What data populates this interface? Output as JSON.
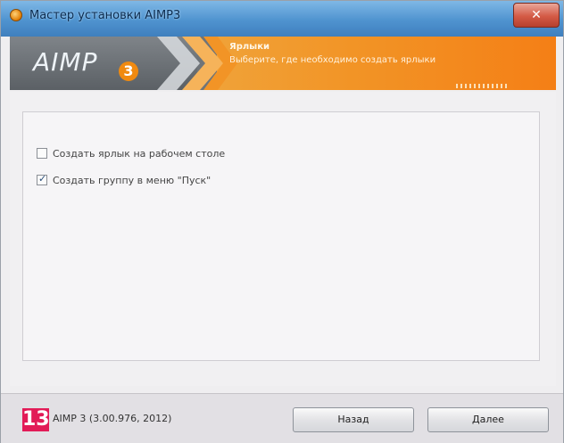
{
  "window": {
    "title": "Мастер установки AIMP3",
    "close_label": "✕"
  },
  "header": {
    "logo": "AIMP",
    "logo_number": "3",
    "step_title": "Ярлыки",
    "step_subtitle": "Выберите, где необходимо создать ярлыки"
  },
  "options": [
    {
      "label": "Создать ярлык на рабочем столе",
      "checked": false
    },
    {
      "label": "Создать группу в меню \"Пуск\"",
      "checked": true
    }
  ],
  "footer": {
    "badge": "13",
    "version": "AIMP 3 (3.00.976, 2012)",
    "back_label": "Назад",
    "next_label": "Далее"
  },
  "colors": {
    "accent_orange": "#f29426",
    "header_gray": "#6f7479",
    "badge_pink": "#e21b57"
  }
}
